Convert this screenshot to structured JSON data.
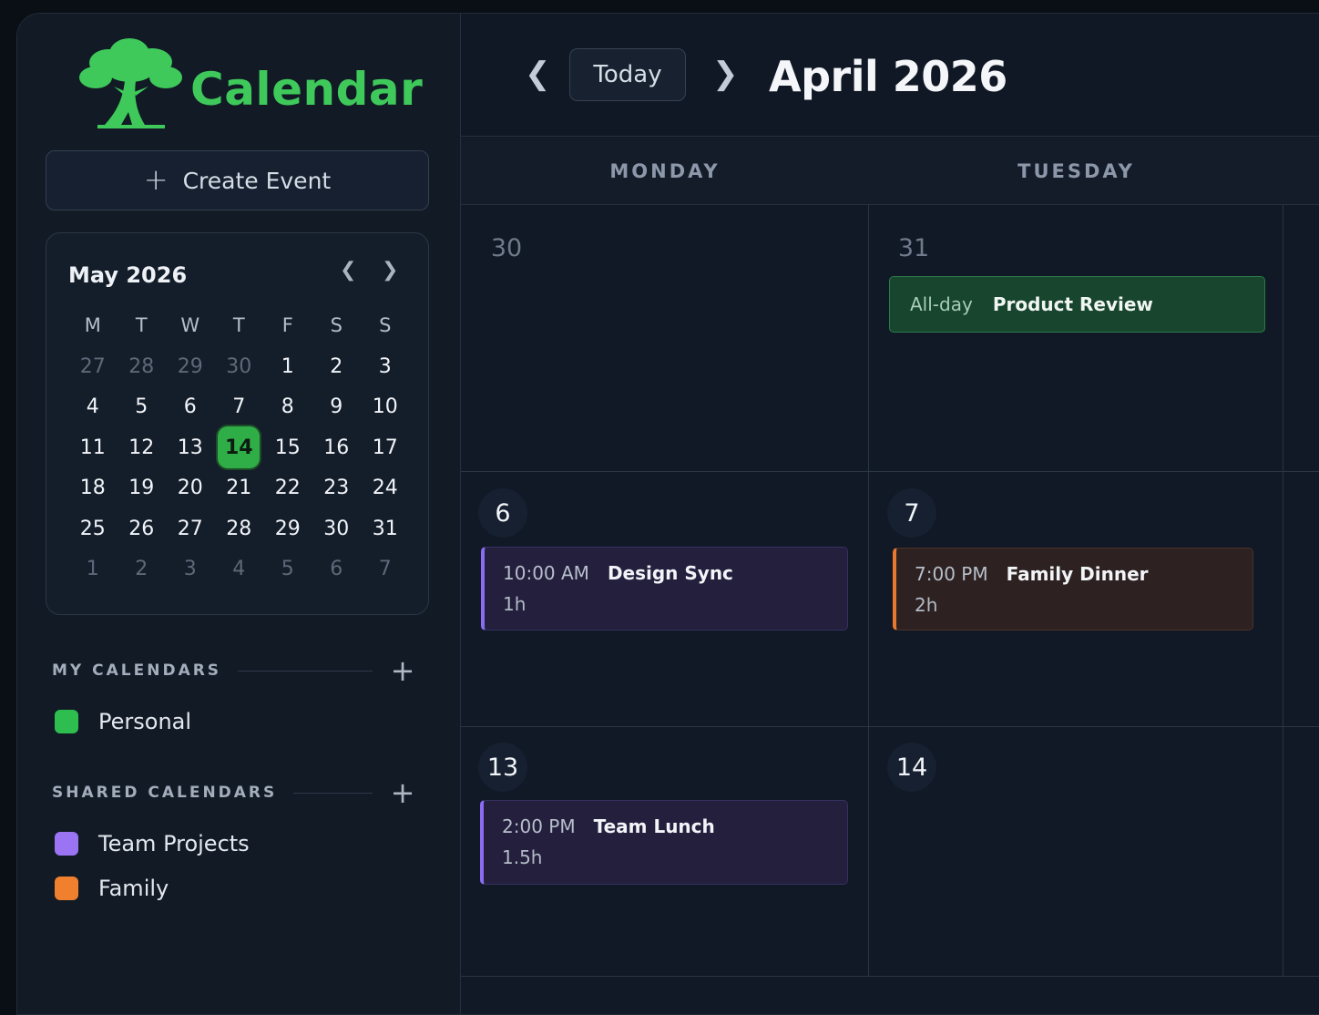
{
  "app": {
    "name": "Calendar"
  },
  "sidebar": {
    "create_label": "Create Event",
    "mini_calendar": {
      "title": "May 2026",
      "weekdays": [
        "M",
        "T",
        "W",
        "T",
        "F",
        "S",
        "S"
      ],
      "weeks": [
        [
          "27",
          "28",
          "29",
          "30",
          "1",
          "2",
          "3"
        ],
        [
          "4",
          "5",
          "6",
          "7",
          "8",
          "9",
          "10"
        ],
        [
          "11",
          "12",
          "13",
          "14",
          "15",
          "16",
          "17"
        ],
        [
          "18",
          "19",
          "20",
          "21",
          "22",
          "23",
          "24"
        ],
        [
          "25",
          "26",
          "27",
          "28",
          "29",
          "30",
          "31"
        ],
        [
          "1",
          "2",
          "3",
          "4",
          "5",
          "6",
          "7"
        ]
      ],
      "selected_day": "14"
    },
    "my_calendars": {
      "label": "MY CALENDARS",
      "items": [
        {
          "name": "Personal",
          "color": "#2ebd4f"
        }
      ]
    },
    "shared_calendars": {
      "label": "SHARED CALENDARS",
      "items": [
        {
          "name": "Team Projects",
          "color": "#9a74f2"
        },
        {
          "name": "Family",
          "color": "#f0802e"
        }
      ]
    }
  },
  "main": {
    "today_label": "Today",
    "title": "April 2026",
    "weekdays": [
      "MONDAY",
      "TUESDAY"
    ],
    "weeks": [
      {
        "days": [
          {
            "num": "30",
            "muted": true,
            "events": []
          },
          {
            "num": "31",
            "muted": true,
            "allday": {
              "tag": "All-day",
              "title": "Product Review"
            }
          }
        ]
      },
      {
        "days": [
          {
            "num": "6",
            "event": {
              "time": "10:00 AM",
              "title": "Design Sync",
              "duration": "1h",
              "calendar": "Team Projects"
            }
          },
          {
            "num": "7",
            "event": {
              "time": "7:00 PM",
              "title": "Family Dinner",
              "duration": "2h",
              "calendar": "Family"
            }
          }
        ]
      },
      {
        "days": [
          {
            "num": "13",
            "event": {
              "time": "2:00 PM",
              "title": "Team Lunch",
              "duration": "1.5h",
              "calendar": "Team Projects"
            }
          },
          {
            "num": "14"
          }
        ]
      }
    ]
  }
}
